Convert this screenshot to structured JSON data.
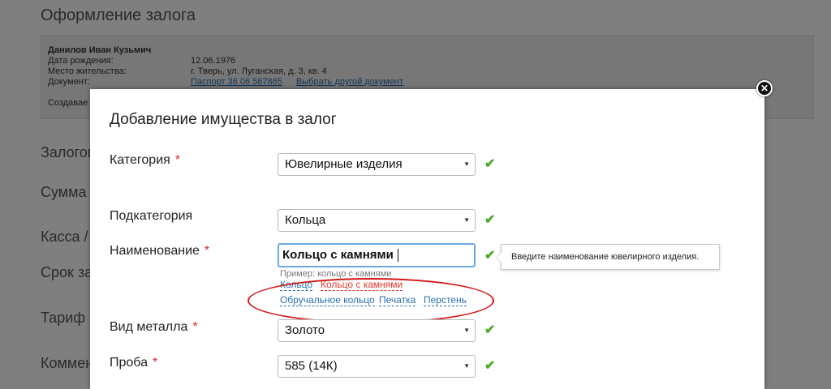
{
  "background": {
    "title": "Оформление залога",
    "client": {
      "name": "Данилов Иван Кузьмич",
      "birth_label": "Дата рождения:",
      "birth_value": "12.06.1976",
      "address_label": "Место жительства:",
      "address_value": "г. Тверь, ул. Луганская, д. 3, кв. 4",
      "document_label": "Документ:",
      "document_value": "Паспорт 36 06 567865",
      "change_document_link": "Выбрать другой документ",
      "created_label": "Создавае"
    },
    "labels": [
      "Залогов",
      "Сумма з",
      "Касса /",
      "Срок за",
      "Тариф",
      "Коммен"
    ]
  },
  "modal": {
    "title": "Добавление имущества в залог",
    "close_icon": "close-icon",
    "fields": {
      "category": {
        "label": "Категория",
        "required_mark": "*",
        "value": "Ювелирные изделия"
      },
      "subcategory": {
        "label": "Подкатегория",
        "value": "Кольца"
      },
      "name": {
        "label": "Наименование",
        "required_mark": "*",
        "value": "Кольцо с камнями",
        "hint": "Пример: кольцо с камнями",
        "tooltip": "Введите наименование ювелирного изделия.",
        "suggestions": [
          "Кольцо",
          "Кольцо с камнями",
          "Обручальное кольцо",
          "Печатка",
          "Перстень"
        ]
      },
      "metal": {
        "label": "Вид металла",
        "required_mark": "*",
        "value": "Золото"
      },
      "assay": {
        "label": "Проба",
        "required_mark": "*",
        "value": "585 (14К)"
      }
    },
    "check_mark": "✔",
    "dropdown_arrow": "▼"
  },
  "colors": {
    "required": "#d9242b",
    "check": "#4caa2c",
    "link": "#2a6fb0",
    "active_suggestion": "#e0392e",
    "annotation": "#d21818"
  }
}
